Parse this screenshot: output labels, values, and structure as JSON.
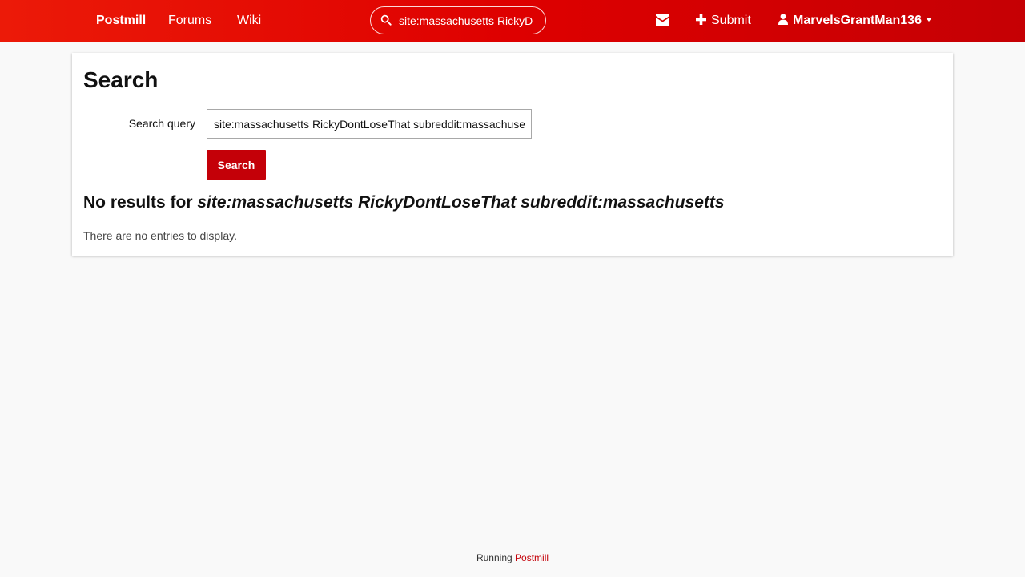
{
  "nav": {
    "brand": "Postmill",
    "forums": "Forums",
    "wiki": "Wiki",
    "search_value": "site:massachusetts RickyDontLoseThat subreddit:massachusetts",
    "submit": "Submit",
    "username": "MarvelsGrantMan136",
    "icons": [
      "search-icon",
      "envelope-icon",
      "plus-icon",
      "user-icon",
      "caret-down-icon"
    ]
  },
  "main": {
    "title": "Search",
    "query_label": "Search query",
    "query_value": "site:massachusetts RickyDontLoseThat subreddit:massachusetts",
    "search_button": "Search",
    "results_prefix": "No results for",
    "results_query": "site:massachusetts RickyDontLoseThat subreddit:massachusetts",
    "empty_message": "There are no entries to display."
  },
  "footer": {
    "prefix": "Running",
    "link": "Postmill"
  },
  "colors": {
    "accent": "#c40008",
    "header_start": "#ec1a08",
    "header_end": "#c50004",
    "background": "#f9f9f9"
  }
}
